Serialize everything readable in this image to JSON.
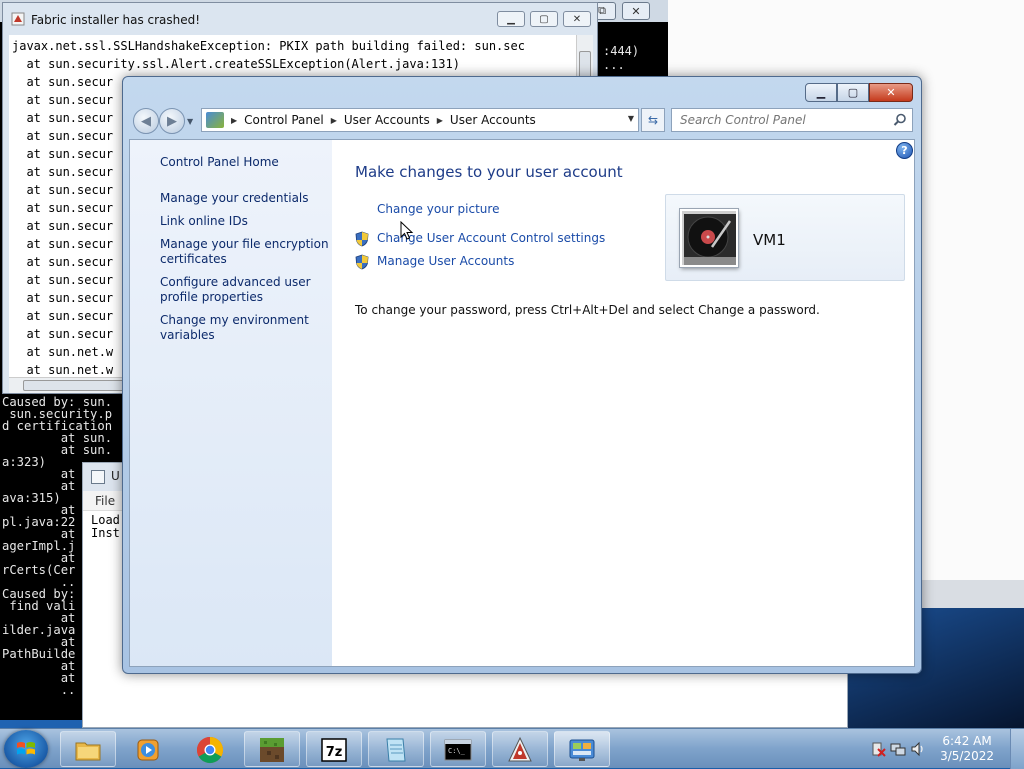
{
  "background": {
    "cmd_right_fragments": [
      ":444)",
      "...",
      "...",
      ""
    ],
    "cmd_lines": [
      "",
      "",
      "",
      "",
      "",
      "",
      "",
      "",
      "",
      "",
      "",
      "",
      "",
      "",
      "",
      "",
      "",
      "",
      "",
      "",
      "",
      "",
      "",
      "",
      "",
      "",
      "",
      "",
      "",
      "",
      "",
      "",
      "",
      "Caused by: sun.",
      " sun.security.p",
      "d certification",
      "        at sun.",
      "        at sun.",
      "a:323)",
      "        at",
      "        at",
      "ava:315)",
      "        at",
      "pl.java:22",
      "        at",
      "agerImpl.j",
      "        at",
      "rCerts(Cer",
      "        ..",
      "Caused by:",
      " find vali",
      "        at",
      "ilder.java",
      "        at",
      "PathBuilde",
      "        at",
      "        at",
      "        .."
    ],
    "note_window": {
      "title": "U",
      "menu_file": "File",
      "body": "Load\nInst"
    }
  },
  "crash_window": {
    "title": "Fabric installer has crashed!",
    "lines": [
      "javax.net.ssl.SSLHandshakeException: PKIX path building failed: sun.sec",
      "  at sun.security.ssl.Alert.createSSLException(Alert.java:131)",
      "  at sun.secur",
      "  at sun.secur",
      "  at sun.secur",
      "  at sun.secur",
      "  at sun.secur",
      "  at sun.secur",
      "  at sun.secur",
      "  at sun.secur",
      "  at sun.secur",
      "  at sun.secur",
      "  at sun.secur",
      "  at sun.secur",
      "  at sun.secur",
      "  at sun.secur",
      "  at sun.secur",
      "  at sun.net.w",
      "  at sun.net.w",
      "  at sun.net.w"
    ]
  },
  "control_panel": {
    "breadcrumb": [
      "Control Panel",
      "User Accounts",
      "User Accounts"
    ],
    "search_placeholder": "Search Control Panel",
    "left_nav": {
      "home": "Control Panel Home",
      "credentials": "Manage your credentials",
      "online_ids": "Link online IDs",
      "encryption_l1": "Manage your file encryption",
      "encryption_l2": "certificates",
      "profile_l1": "Configure advanced user",
      "profile_l2": "profile properties",
      "env_l1": "Change my environment",
      "env_l2": "variables"
    },
    "main": {
      "title": "Make changes to your user account",
      "change_picture": "Change your picture",
      "uac_settings": "Change User Account Control settings",
      "manage_accounts": "Manage User Accounts",
      "password_note": "To change your password, press Ctrl+Alt+Del and select Change a password."
    },
    "user": {
      "name": "VM1"
    }
  },
  "taskbar": {
    "time": "6:42 AM",
    "date": "3/5/2022"
  },
  "icons": [
    "start-orb-icon",
    "explorer-icon",
    "media-player-icon",
    "chrome-icon",
    "minecraft-icon",
    "7zip-icon",
    "notepad-icon",
    "cmd-icon",
    "java-icon",
    "control-panel-icon",
    "help-icon",
    "shield-icon",
    "search-icon",
    "refresh-icon"
  ]
}
